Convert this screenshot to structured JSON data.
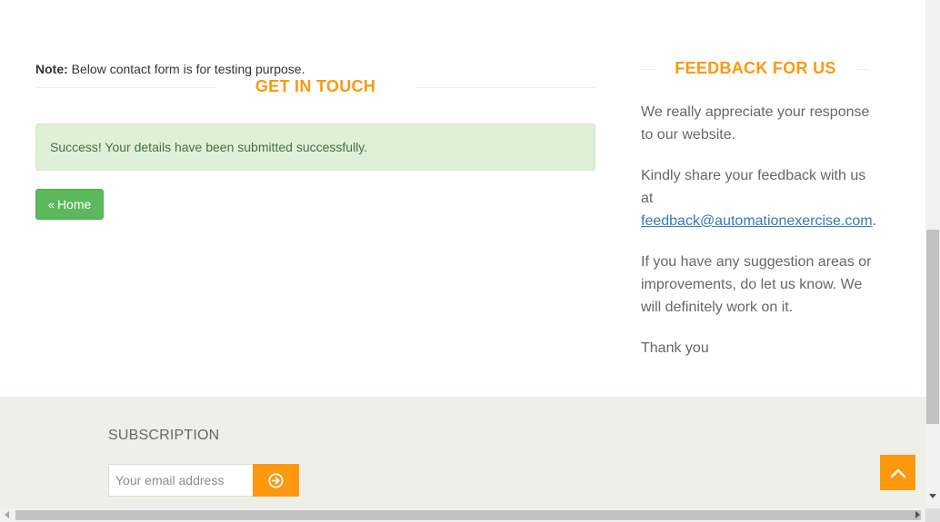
{
  "contact": {
    "note_label": "Note:",
    "note_text": " Below contact form is for testing purpose.",
    "title": "GET IN TOUCH",
    "success_message": "Success! Your details have been submitted successfully.",
    "home_button_label": "Home",
    "home_icon": "angle-double-left-icon"
  },
  "feedback": {
    "title": "FEEDBACK FOR US",
    "p1": "We really appreciate your response to our website.",
    "p2_text": "Kindly share your feedback with us at ",
    "p2_link": "feedback@automationexercise.com",
    "p2_tail": ".",
    "p3": "If you have any suggestion areas or improvements, do let us know. We will definitely work on it.",
    "p4": "Thank you"
  },
  "footer": {
    "subscription_title": "SUBSCRIPTION",
    "email_placeholder": "Your email address",
    "subscribe_icon": "arrow-circle-right-icon"
  },
  "scroll_top_icon": "chevron-up-icon",
  "colors": {
    "accent": "#fe980f",
    "success_bg": "#dff0d8",
    "success_text": "#3c763d",
    "button_green": "#5cb85c",
    "footer_bg": "#efefe9",
    "link": "#337ab7"
  }
}
